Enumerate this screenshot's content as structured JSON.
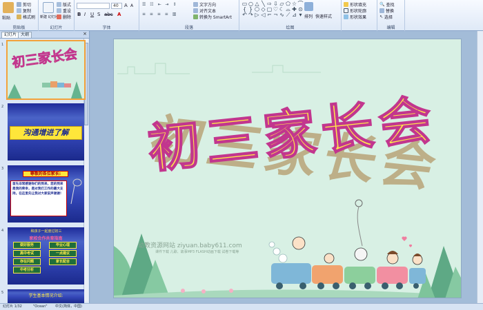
{
  "ribbon": {
    "clipboard": {
      "paste": "粘贴",
      "cut": "剪切",
      "copy": "复制",
      "format_painter": "格式刷",
      "group_label": "剪贴板"
    },
    "slides": {
      "new_slide": "新建\n幻灯片",
      "layout": "版式",
      "reset": "重设",
      "delete": "删除",
      "group_label": "幻灯片"
    },
    "font": {
      "font_size": "40",
      "group_label": "字体"
    },
    "paragraph": {
      "text_direction": "文字方向",
      "align_text": "对齐文本",
      "convert_smartart": "转换为 SmartArt",
      "group_label": "段落"
    },
    "drawing": {
      "arrange": "排列",
      "quick_styles": "快速样式",
      "shape_fill": "形状填充",
      "shape_outline": "形状轮廓",
      "shape_effects": "形状效果",
      "group_label": "绘图"
    },
    "editing": {
      "find": "查找",
      "replace": "替换",
      "select": "选择",
      "group_label": "编辑"
    }
  },
  "panel": {
    "tab_slides": "幻灯片",
    "tab_outline": "大纲"
  },
  "thumbnails": [
    {
      "num": "1",
      "title": "初三家长会"
    },
    {
      "num": "2",
      "title": "沟通增进了解"
    },
    {
      "num": "3",
      "title": "尊敬的各位家长:",
      "body": "首先非常感谢你们的到来，您的到来是我的荣幸，是对我们工作的最大支持。在这里先让我对大家说声谢谢！"
    },
    {
      "num": "4",
      "header": "和孩子一起度过初三",
      "sub": "家校合作共育指南",
      "items": [
        "做好服务",
        "高中考试",
        "存在问题",
        "中考分析",
        "毕业心理",
        "一点建议",
        "家长配合"
      ]
    },
    {
      "num": "5",
      "title": "学生基本情况介绍:"
    }
  ],
  "slide": {
    "title": "初三家长会",
    "watermark": "幼教资源网站  ziyuan.baby611.com",
    "watermark_sub": "课件下载  儿歌、故事MP3 FLASH动画下载  试卷下载等"
  },
  "status": {
    "slide_info": "幻灯片 1/32",
    "theme": "\"Ocean\"",
    "language": "中文(简体，中国)"
  },
  "colors": {
    "title_fill": "#ffe84a",
    "title_stroke": "#c2368e",
    "slide_bg": "#d8f0e4",
    "ocean_dark": "#1f2c9a",
    "thumb_highlight": "#f3a23a"
  }
}
